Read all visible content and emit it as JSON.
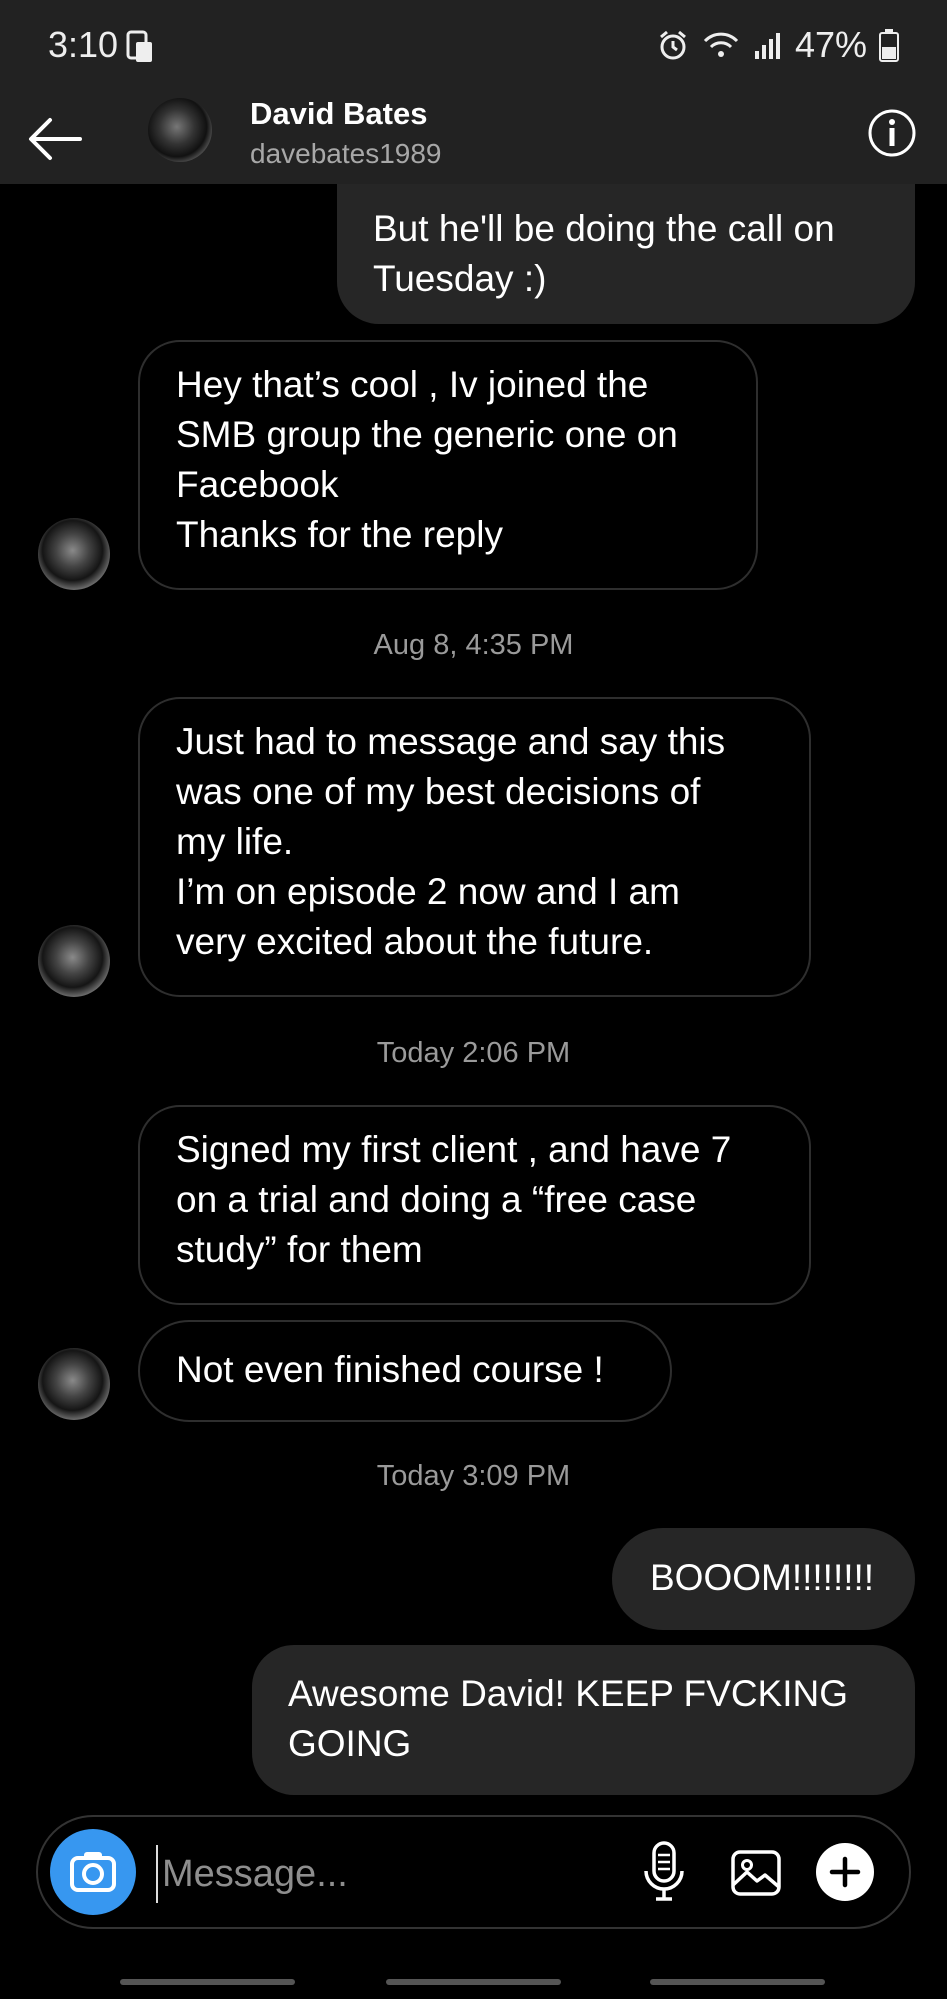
{
  "status_bar": {
    "time": "3:10",
    "battery": "47%"
  },
  "header": {
    "name": "David Bates",
    "username": "davebates1989"
  },
  "messages": [
    {
      "from": "me",
      "lines": [
        "But he'll be doing the call on",
        "Tuesday :)"
      ]
    },
    {
      "from": "them",
      "lines": [
        "Hey that’s cool , Iv joined the",
        "SMB group the generic one on",
        "Facebook",
        "Thanks for the reply"
      ]
    },
    {
      "timestamp": "Aug 8, 4:35 PM"
    },
    {
      "from": "them",
      "lines": [
        "Just had to message and say this",
        "was one of my best decisions of",
        "my life.",
        "I’m on episode 2 now and I am",
        "very excited about the future."
      ]
    },
    {
      "timestamp": "Today 2:06 PM"
    },
    {
      "from": "them",
      "lines": [
        "Signed my first client , and have 7",
        "on a trial and doing a “free case",
        "study” for them"
      ]
    },
    {
      "from": "them",
      "lines": [
        "Not even finished course !"
      ]
    },
    {
      "timestamp": "Today 3:09 PM"
    },
    {
      "from": "me",
      "lines": [
        "BOOOM!!!!!!!!"
      ]
    },
    {
      "from": "me",
      "lines": [
        "Awesome David! KEEP FVCKING",
        "GOING"
      ]
    }
  ],
  "composer": {
    "placeholder": "Message...",
    "icons": [
      "camera-icon",
      "microphone-icon",
      "gallery-icon",
      "plus-icon"
    ]
  },
  "colors": {
    "accent": "#3797f0",
    "outgoing_bubble": "#262626",
    "background": "#000000",
    "header": "#222222"
  }
}
